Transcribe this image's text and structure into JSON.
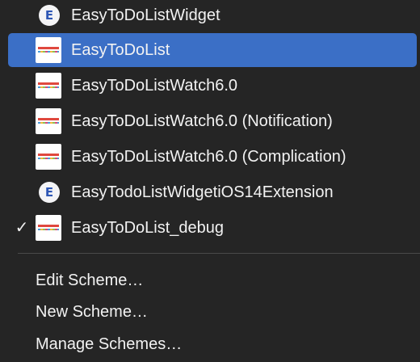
{
  "schemes": [
    {
      "label": "EasyToDoListWidget",
      "icon": "extension-icon",
      "selected": false,
      "checked": false
    },
    {
      "label": "EasyToDoList",
      "icon": "app-icon",
      "selected": true,
      "checked": false
    },
    {
      "label": "EasyToDoListWatch6.0",
      "icon": "app-icon",
      "selected": false,
      "checked": false
    },
    {
      "label": "EasyToDoListWatch6.0 (Notification)",
      "icon": "app-icon",
      "selected": false,
      "checked": false
    },
    {
      "label": "EasyToDoListWatch6.0 (Complication)",
      "icon": "app-icon",
      "selected": false,
      "checked": false
    },
    {
      "label": "EasyTodoListWidgetiOS14Extension",
      "icon": "extension-icon",
      "selected": false,
      "checked": false
    },
    {
      "label": "EasyToDoList_debug",
      "icon": "app-icon",
      "selected": false,
      "checked": true
    }
  ],
  "check_glyph": "✓",
  "extension_glyph": "E",
  "actions": [
    {
      "label": "Edit Scheme…"
    },
    {
      "label": "New Scheme…"
    },
    {
      "label": "Manage Schemes…"
    }
  ],
  "colors": {
    "menu_background": "#252525",
    "selection": "#3b6fc6",
    "text": "#f2f2f2"
  }
}
